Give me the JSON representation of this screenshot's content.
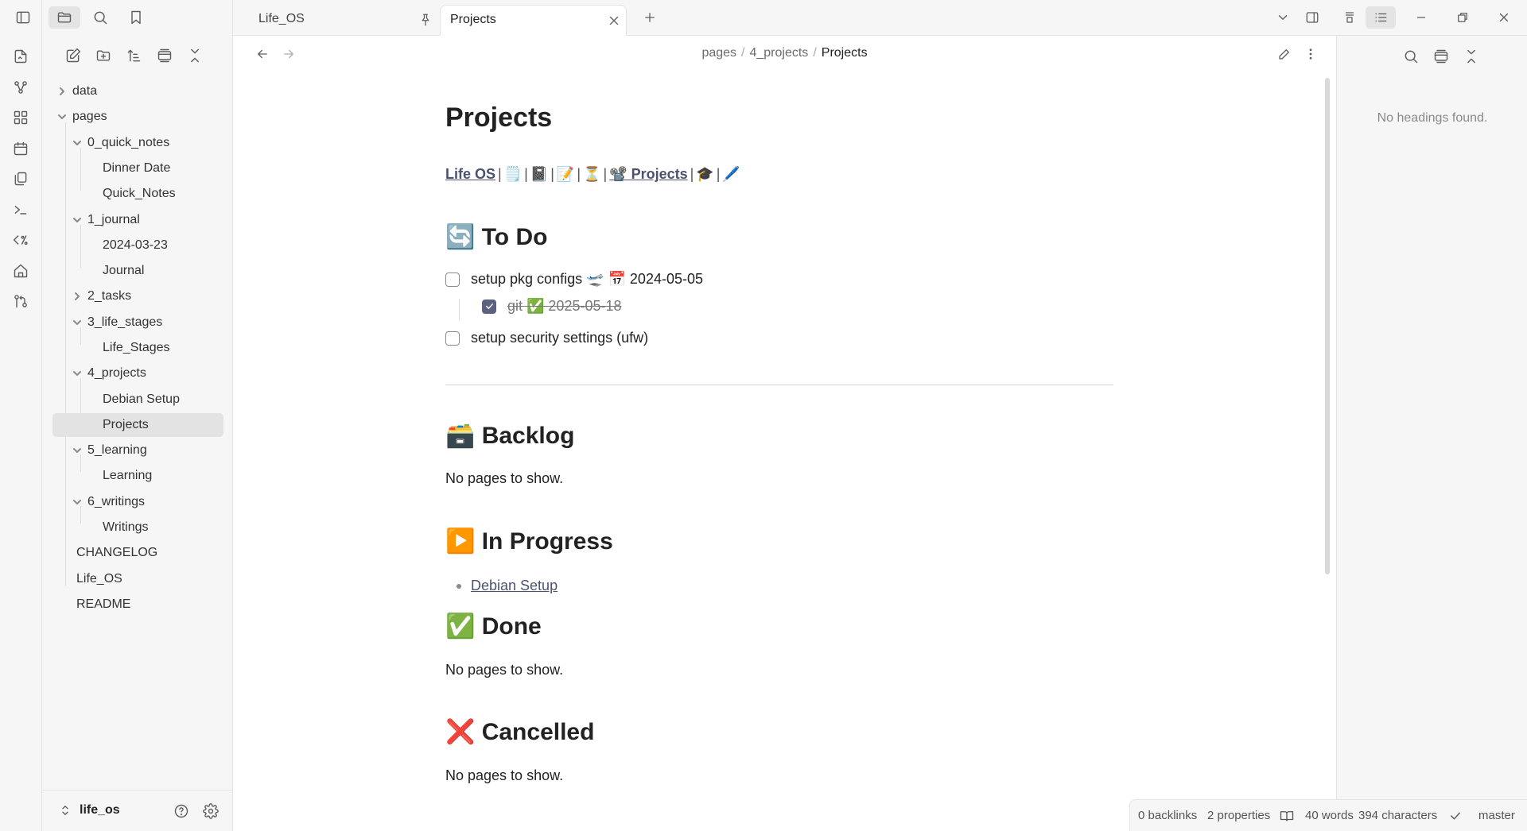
{
  "tabs": [
    {
      "label": "Life_OS",
      "pinned": true
    },
    {
      "label": "Projects",
      "active": true
    }
  ],
  "breadcrumb": {
    "parts": [
      "pages",
      "4_projects"
    ],
    "current": "Projects"
  },
  "file_tree": {
    "items": [
      {
        "label": "data"
      },
      {
        "label": "pages"
      },
      {
        "label": "0_quick_notes"
      },
      {
        "label": "Dinner Date"
      },
      {
        "label": "Quick_Notes"
      },
      {
        "label": "1_journal"
      },
      {
        "label": "2024-03-23"
      },
      {
        "label": "Journal"
      },
      {
        "label": "2_tasks"
      },
      {
        "label": "3_life_stages"
      },
      {
        "label": "Life_Stages"
      },
      {
        "label": "4_projects"
      },
      {
        "label": "Debian Setup"
      },
      {
        "label": "Projects"
      },
      {
        "label": "5_learning"
      },
      {
        "label": "Learning"
      },
      {
        "label": "6_writings"
      },
      {
        "label": "Writings"
      },
      {
        "label": "CHANGELOG"
      },
      {
        "label": "Life_OS"
      },
      {
        "label": "README"
      }
    ]
  },
  "vault": {
    "name": "life_os"
  },
  "note": {
    "title": "Projects",
    "nav": {
      "home_link": "Life OS",
      "emojis": [
        "🗒️",
        "📓",
        "📝",
        "⏳"
      ],
      "projects_emoji": "📽️",
      "projects_link": "Projects",
      "tail_emojis": [
        "🎓",
        "🖊️"
      ],
      "separator": "|"
    },
    "sections": {
      "todo": {
        "emoji": "🔄",
        "title": "To Do"
      },
      "backlog": {
        "emoji": "🗃️",
        "title": "Backlog",
        "empty": "No pages to show."
      },
      "in_progress": {
        "emoji": "▶️",
        "title": "In Progress",
        "links": [
          "Debian Setup"
        ]
      },
      "done": {
        "emoji": "✅",
        "title": "Done",
        "empty": "No pages to show."
      },
      "cancelled": {
        "emoji": "❌",
        "title": "Cancelled",
        "empty": "No pages to show."
      }
    },
    "tasks": [
      {
        "text": "setup pkg configs 🛫 📅 2024-05-05",
        "checked": false
      },
      {
        "text": "git ✅ 2025-05-18",
        "checked": true
      },
      {
        "text": "setup security settings (ufw)",
        "checked": false
      }
    ]
  },
  "outline": {
    "empty": "No headings found."
  },
  "status": {
    "backlinks": "0 backlinks",
    "properties": "2 properties",
    "words": "40 words",
    "characters": "394 characters",
    "branch": "master"
  }
}
